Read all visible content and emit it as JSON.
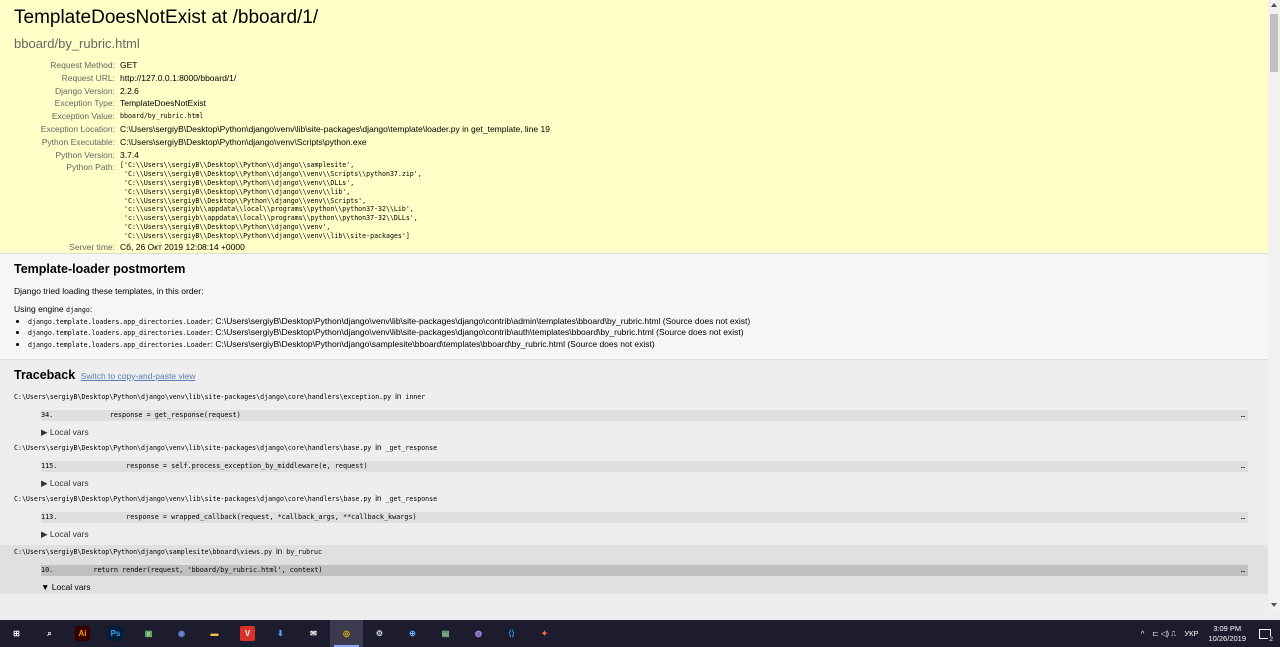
{
  "summary": {
    "title": "TemplateDoesNotExist at /bboard/1/",
    "subtitle": "bboard/by_rubric.html",
    "meta": [
      {
        "label": "Request Method:",
        "value": "GET",
        "mono": false
      },
      {
        "label": "Request URL:",
        "value": "http://127.0.0.1:8000/bboard/1/",
        "mono": false
      },
      {
        "label": "Django Version:",
        "value": "2.2.6",
        "mono": false
      },
      {
        "label": "Exception Type:",
        "value": "TemplateDoesNotExist",
        "mono": false
      },
      {
        "label": "Exception Value:",
        "value": "bboard/by_rubric.html",
        "mono": true
      },
      {
        "label": "Exception Location:",
        "value": "C:\\Users\\sergiyB\\Desktop\\Python\\django\\venv\\lib\\site-packages\\django\\template\\loader.py in get_template, line 19",
        "mono": false
      },
      {
        "label": "Python Executable:",
        "value": "C:\\Users\\sergiyB\\Desktop\\Python\\django\\venv\\Scripts\\python.exe",
        "mono": false
      },
      {
        "label": "Python Version:",
        "value": "3.7.4",
        "mono": false
      }
    ],
    "python_path_label": "Python Path:",
    "python_path": "['C:\\\\Users\\\\sergiyB\\\\Desktop\\\\Python\\\\django\\\\samplesite',\n 'C:\\\\Users\\\\sergiyB\\\\Desktop\\\\Python\\\\django\\\\venv\\\\Scripts\\\\python37.zip',\n 'C:\\\\Users\\\\sergiyB\\\\Desktop\\\\Python\\\\django\\\\venv\\\\DLLs',\n 'C:\\\\Users\\\\sergiyB\\\\Desktop\\\\Python\\\\django\\\\venv\\\\lib',\n 'C:\\\\Users\\\\sergiyB\\\\Desktop\\\\Python\\\\django\\\\venv\\\\Scripts',\n 'c:\\\\users\\\\sergiyb\\\\appdata\\\\local\\\\programs\\\\python\\\\python37-32\\\\Lib',\n 'c:\\\\users\\\\sergiyb\\\\appdata\\\\local\\\\programs\\\\python\\\\python37-32\\\\DLLs',\n 'C:\\\\Users\\\\sergiyB\\\\Desktop\\\\Python\\\\django\\\\venv',\n 'C:\\\\Users\\\\sergiyB\\\\Desktop\\\\Python\\\\django\\\\venv\\\\lib\\\\site-packages']",
    "server_time_label": "Server time:",
    "server_time": "Сб, 26 Окт 2019 12:08:14 +0000"
  },
  "postmortem": {
    "heading": "Template-loader postmortem",
    "intro": "Django tried loading these templates, in this order:",
    "engine_prefix": "Using engine",
    "engine_name": "django",
    "engine_suffix": ":",
    "items": [
      {
        "loader": "django.template.loaders.app_directories.Loader",
        "path": ": C:\\Users\\sergiyB\\Desktop\\Python\\django\\venv\\lib\\site-packages\\django\\contrib\\admin\\templates\\bboard\\by_rubric.html (Source does not exist)"
      },
      {
        "loader": "django.template.loaders.app_directories.Loader",
        "path": ": C:\\Users\\sergiyB\\Desktop\\Python\\django\\venv\\lib\\site-packages\\django\\contrib\\auth\\templates\\bboard\\by_rubric.html (Source does not exist)"
      },
      {
        "loader": "django.template.loaders.app_directories.Loader",
        "path": ": C:\\Users\\sergiyB\\Desktop\\Python\\django\\samplesite\\bboard\\templates\\bboard\\by_rubric.html (Source does not exist)"
      }
    ]
  },
  "traceback": {
    "heading": "Traceback",
    "switch_link": "Switch to copy-and-paste view",
    "frames": [
      {
        "file": "C:\\Users\\sergiyB\\Desktop\\Python\\django\\venv\\lib\\site-packages\\django\\core\\handlers\\exception.py",
        "in": "in",
        "func": "inner",
        "line_no": "34.",
        "code": "        response = get_response(request)",
        "ellipsis": "…",
        "local_vars": "▶ Local vars"
      },
      {
        "file": "C:\\Users\\sergiyB\\Desktop\\Python\\django\\venv\\lib\\site-packages\\django\\core\\handlers\\base.py",
        "in": "in",
        "func": "_get_response",
        "line_no": "115.",
        "code": "            response = self.process_exception_by_middleware(e, request)",
        "ellipsis": "…",
        "local_vars": "▶ Local vars"
      },
      {
        "file": "C:\\Users\\sergiyB\\Desktop\\Python\\django\\venv\\lib\\site-packages\\django\\core\\handlers\\base.py",
        "in": "in",
        "func": "_get_response",
        "line_no": "113.",
        "code": "            response = wrapped_callback(request, *callback_args, **callback_kwargs)",
        "ellipsis": "…",
        "local_vars": "▶ Local vars"
      },
      {
        "file": "C:\\Users\\sergiyB\\Desktop\\Python\\django\\samplesite\\bboard\\views.py",
        "in": "in",
        "func": "by_rubruc",
        "line_no": "10.",
        "code": "    return render(request, 'bboard/by_rubric.html', context)",
        "ellipsis": "…",
        "local_vars": "▼ Local vars"
      }
    ]
  },
  "taskbar": {
    "icons": [
      {
        "name": "windows-start-icon",
        "glyph": "⊞",
        "color": "#ffffff",
        "bg": "transparent"
      },
      {
        "name": "search-icon",
        "glyph": "⌕",
        "color": "#ffffff",
        "bg": "transparent"
      },
      {
        "name": "illustrator-icon",
        "glyph": "Ai",
        "color": "#ff9a00",
        "bg": "#330000"
      },
      {
        "name": "photoshop-icon",
        "glyph": "Ps",
        "color": "#31a8ff",
        "bg": "#001e36"
      },
      {
        "name": "image-viewer-icon",
        "glyph": "▣",
        "color": "#7fd17f",
        "bg": "transparent"
      },
      {
        "name": "discord-icon",
        "glyph": "◉",
        "color": "#7289da",
        "bg": "transparent"
      },
      {
        "name": "file-explorer-icon",
        "glyph": "▬",
        "color": "#f6c445",
        "bg": "transparent"
      },
      {
        "name": "vivaldi-icon",
        "glyph": "V",
        "color": "#ffffff",
        "bg": "#d9322b"
      },
      {
        "name": "installer-icon",
        "glyph": "⬇",
        "color": "#4aa3ff",
        "bg": "transparent"
      },
      {
        "name": "mail-icon",
        "glyph": "✉",
        "color": "#ffffff",
        "bg": "transparent"
      },
      {
        "name": "chrome-icon",
        "glyph": "◎",
        "color": "#f2b705",
        "bg": "transparent"
      },
      {
        "name": "steam-icon",
        "glyph": "⚙",
        "color": "#c7d5e0",
        "bg": "transparent"
      },
      {
        "name": "network-globe-icon",
        "glyph": "⊕",
        "color": "#5fb3ff",
        "bg": "transparent"
      },
      {
        "name": "terminal-icon",
        "glyph": "▤",
        "color": "#8fd18f",
        "bg": "transparent"
      },
      {
        "name": "media-player-icon",
        "glyph": "◍",
        "color": "#b48cff",
        "bg": "transparent"
      },
      {
        "name": "vscode-icon",
        "glyph": "⟨⟩",
        "color": "#22a7f0",
        "bg": "transparent"
      },
      {
        "name": "app-red-icon",
        "glyph": "✦",
        "color": "#ff6a3d",
        "bg": "transparent"
      }
    ],
    "active_index": 10,
    "tray_chevron": "^",
    "tray_icons": "⊏ ◁) ⎍",
    "language": "УКР",
    "time": "3:09 PM",
    "date": "10/26/2019",
    "notification_count": "2"
  }
}
